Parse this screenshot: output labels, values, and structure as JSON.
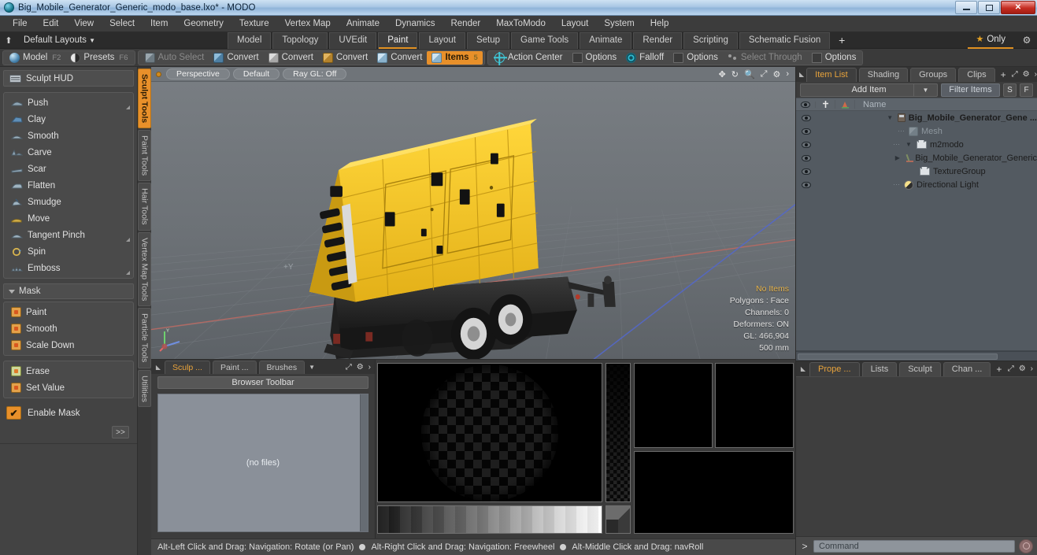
{
  "titlebar": {
    "title": "Big_Mobile_Generator_Generic_modo_base.lxo* - MODO",
    "app_icon": "modo-icon",
    "minimize": "minimize-icon",
    "maximize": "maximize-icon",
    "close": "close-icon"
  },
  "menubar": {
    "items": [
      {
        "label": "File"
      },
      {
        "label": "Edit"
      },
      {
        "label": "View"
      },
      {
        "label": "Select"
      },
      {
        "label": "Item"
      },
      {
        "label": "Geometry"
      },
      {
        "label": "Texture"
      },
      {
        "label": "Vertex Map"
      },
      {
        "label": "Animate"
      },
      {
        "label": "Dynamics"
      },
      {
        "label": "Render"
      },
      {
        "label": "MaxToModo"
      },
      {
        "label": "Layout"
      },
      {
        "label": "System"
      },
      {
        "label": "Help"
      }
    ]
  },
  "layout_row": {
    "default_layouts": "Default Layouts",
    "dropdown_caret": "▼",
    "tabs": [
      {
        "label": "Model",
        "active": false
      },
      {
        "label": "Topology",
        "active": false
      },
      {
        "label": "UVEdit",
        "active": false
      },
      {
        "label": "Paint",
        "active": true
      },
      {
        "label": "Layout",
        "active": false
      },
      {
        "label": "Setup",
        "active": false
      },
      {
        "label": "Game Tools",
        "active": false
      },
      {
        "label": "Animate",
        "active": false
      },
      {
        "label": "Render",
        "active": false
      },
      {
        "label": "Scripting",
        "active": false
      },
      {
        "label": "Schematic Fusion",
        "active": false
      }
    ],
    "add_tab": "+",
    "only_label": "Only",
    "star_icon": "star-icon",
    "gear_icon": "gear-icon"
  },
  "modebar": {
    "group1": [
      {
        "label": "Model",
        "key": "F2",
        "icon": "sphere-icon",
        "state": "normal"
      },
      {
        "label": "Presets",
        "key": "F6",
        "icon": "half-circle-icon",
        "state": "normal"
      }
    ],
    "group2": [
      {
        "label": "Auto Select",
        "key": "",
        "icon": "cube-gray-icon",
        "state": "dim"
      },
      {
        "label": "Convert",
        "key": "",
        "icon": "cube-blue-icon",
        "state": "normal"
      },
      {
        "label": "Convert",
        "key": "",
        "icon": "cube-white-icon",
        "state": "normal"
      },
      {
        "label": "Convert",
        "key": "",
        "icon": "cube-orange-icon",
        "state": "normal"
      },
      {
        "label": "Convert",
        "key": "",
        "icon": "cube-teal-icon",
        "state": "normal"
      },
      {
        "label": "Items",
        "key": "5",
        "icon": "cube-items-icon",
        "state": "active"
      }
    ],
    "group3": [
      {
        "label": "Action Center",
        "key": "",
        "icon": "action-center-icon",
        "state": "normal"
      },
      {
        "label": "Options",
        "key": "",
        "icon": "checkbox-icon",
        "state": "normal"
      },
      {
        "label": "Falloff",
        "key": "",
        "icon": "falloff-icon",
        "state": "normal"
      },
      {
        "label": "Options",
        "key": "",
        "icon": "checkbox-icon",
        "state": "normal"
      },
      {
        "label": "Select Through",
        "key": "",
        "icon": "select-through-icon",
        "state": "dim"
      },
      {
        "label": "Options",
        "key": "",
        "icon": "checkbox-icon",
        "state": "normal"
      }
    ]
  },
  "sculpt_panel": {
    "hud_button": "Sculpt HUD",
    "brush_tools": [
      {
        "label": "Push",
        "icon": "brush-push-icon",
        "corner": true
      },
      {
        "label": "Clay",
        "icon": "brush-clay-icon",
        "corner": false
      },
      {
        "label": "Smooth",
        "icon": "brush-smooth-icon",
        "corner": false
      },
      {
        "label": "Carve",
        "icon": "brush-carve-icon",
        "corner": false
      },
      {
        "label": "Scar",
        "icon": "brush-scar-icon",
        "corner": false
      },
      {
        "label": "Flatten",
        "icon": "brush-flatten-icon",
        "corner": false
      },
      {
        "label": "Smudge",
        "icon": "brush-smudge-icon",
        "corner": false
      },
      {
        "label": "Move",
        "icon": "brush-move-icon",
        "corner": false
      },
      {
        "label": "Tangent Pinch",
        "icon": "brush-pinch-icon",
        "corner": true
      },
      {
        "label": "Spin",
        "icon": "brush-spin-icon",
        "corner": false
      },
      {
        "label": "Emboss",
        "icon": "brush-emboss-icon",
        "corner": true
      }
    ],
    "mask_header": "Mask",
    "mask_tools": [
      {
        "label": "Paint",
        "icon": "mask-paint-icon"
      },
      {
        "label": "Smooth",
        "icon": "mask-smooth-icon"
      },
      {
        "label": "Scale Down",
        "icon": "mask-scale-down-icon"
      }
    ],
    "mask_tools2": [
      {
        "label": "Erase",
        "icon": "mask-erase-icon"
      },
      {
        "label": "Set Value",
        "icon": "mask-set-value-icon"
      }
    ],
    "enable_mask": {
      "label": "Enable Mask",
      "checked": true,
      "check_glyph": "✔"
    },
    "more_button": ">>"
  },
  "vertical_tabs": [
    {
      "label": "Sculpt Tools",
      "active": true
    },
    {
      "label": "Paint Tools",
      "active": false
    },
    {
      "label": "Hair Tools",
      "active": false
    },
    {
      "label": "Vertex Map Tools",
      "active": false
    },
    {
      "label": "Particle Tools",
      "active": false
    },
    {
      "label": "Utilities",
      "active": false
    }
  ],
  "viewport": {
    "header_chips": [
      {
        "label": "Perspective"
      },
      {
        "label": "Default"
      },
      {
        "label": "Ray GL: Off"
      }
    ],
    "header_icons": [
      "move-icon",
      "rotate-icon",
      "zoom-icon",
      "fullscreen-icon",
      "gear-icon",
      "chevron-right-icon"
    ],
    "hud": [
      "No Items",
      "Polygons : Face",
      "Channels: 0",
      "Deformers: ON",
      "GL: 466,904",
      "500 mm"
    ],
    "plus_marker": "+Y",
    "axis_gizmo": "axis-gizmo-icon",
    "model_description": "yellow mobile generator on black trailer"
  },
  "bottom_browser": {
    "tabs": [
      {
        "label": "Sculp ...",
        "active": true
      },
      {
        "label": "Paint ...",
        "active": false
      },
      {
        "label": "Brushes",
        "active": false
      }
    ],
    "tab_caret": "▼",
    "tab_icons": [
      "fullscreen-icon",
      "gear-icon",
      "chevron-right-icon"
    ],
    "toolbar_label": "Browser Toolbar",
    "files_empty": "(no files)"
  },
  "statusbar": {
    "hints": [
      "Alt-Left Click and Drag: Navigation: Rotate (or Pan)",
      "Alt-Right Click and Drag: Navigation: Freewheel",
      "Alt-Middle Click and Drag: navRoll"
    ]
  },
  "item_list": {
    "tabs": [
      {
        "label": "Item List",
        "active": true
      },
      {
        "label": "Shading",
        "active": false
      },
      {
        "label": "Groups",
        "active": false
      },
      {
        "label": "Clips",
        "active": false
      }
    ],
    "add_tab": "+",
    "tab_icons": [
      "fullscreen-icon",
      "gear-icon",
      "chevron-right-icon"
    ],
    "add_item_label": "Add Item",
    "add_item_caret": "▼",
    "filter_placeholder": "Filter Items",
    "button_s": "S",
    "button_f": "F",
    "columns": {
      "eye": "visibility-icon",
      "lock": "lock-icon",
      "render": "render-icon",
      "name": "Name"
    },
    "rows": [
      {
        "label": "Big_Mobile_Generator_Gene ...",
        "icon": "scene-icon",
        "indent": 0,
        "twirl": "▼",
        "bold": true,
        "dim": false
      },
      {
        "label": "Mesh",
        "icon": "mesh-icon",
        "indent": 1,
        "twirl": "",
        "bold": false,
        "dim": true
      },
      {
        "label": "m2modo",
        "icon": "folder-icon",
        "indent": 1,
        "twirl": "▼",
        "bold": false,
        "dim": false
      },
      {
        "label": "Big_Mobile_Generator_Generic",
        "icon": "locator-icon",
        "indent": 2,
        "twirl": "▶",
        "bold": false,
        "dim": false
      },
      {
        "label": "TextureGroup",
        "icon": "folder-icon",
        "indent": 2,
        "twirl": "",
        "bold": false,
        "dim": false
      },
      {
        "label": "Directional Light",
        "icon": "light-icon",
        "indent": 1,
        "twirl": "",
        "bold": false,
        "dim": false
      }
    ]
  },
  "properties_panel": {
    "tabs": [
      {
        "label": "Prope ...",
        "active": true
      },
      {
        "label": "Lists",
        "active": false
      },
      {
        "label": "Sculpt",
        "active": false
      },
      {
        "label": "Chan ...",
        "active": false
      }
    ],
    "add_tab": "+",
    "tab_icons": [
      "fullscreen-icon",
      "gear-icon",
      "chevron-right-icon"
    ]
  },
  "command_bar": {
    "prompt": ">",
    "placeholder": "Command",
    "record_icon": "record-icon"
  }
}
